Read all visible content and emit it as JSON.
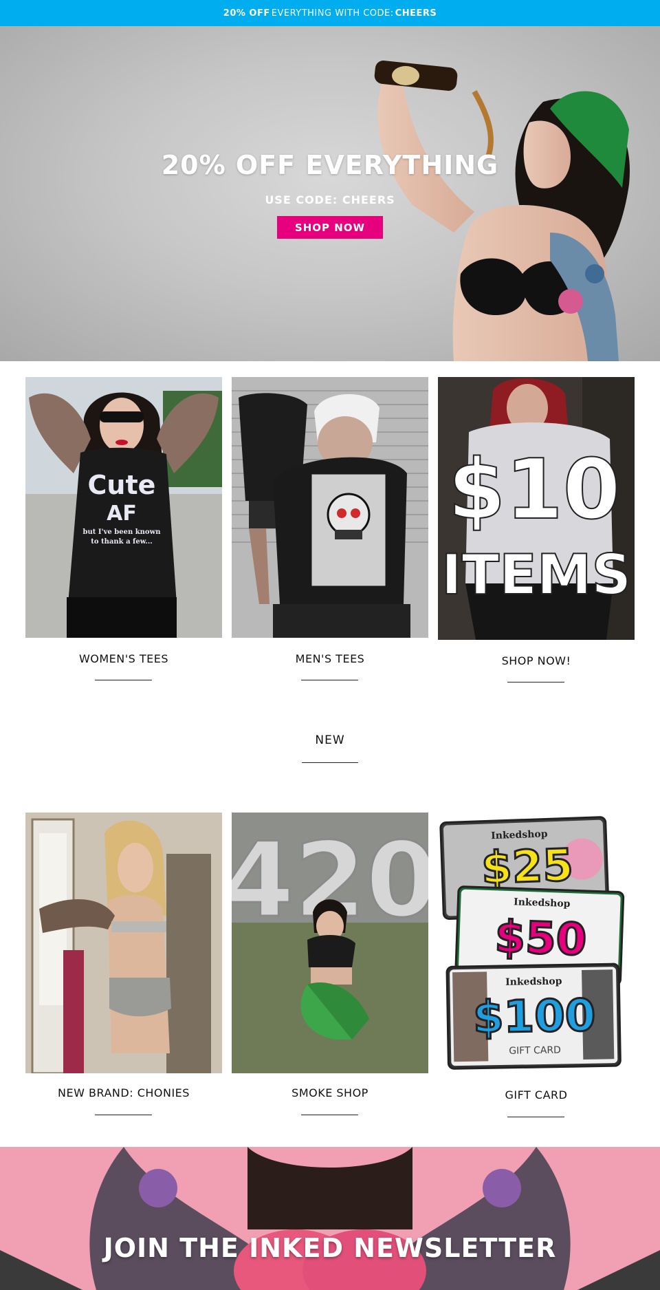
{
  "promo_bar": {
    "prefix": "20% OFF",
    "middle": "EVERYTHING WITH CODE:",
    "code": "CHEERS"
  },
  "hero": {
    "title": "20% OFF EVERYTHING",
    "subtitle": "USE CODE: CHEERS",
    "button": "SHOP NOW"
  },
  "tiles": [
    {
      "label": "WOMEN'S TEES",
      "shirt_text_1": "Cute",
      "shirt_text_2": "AF",
      "shirt_text_3": "but I've been known",
      "shirt_text_4": "to thank a few..."
    },
    {
      "label": "MEN'S TEES"
    },
    {
      "label": "SHOP NOW!",
      "image_text_1": "$10",
      "image_text_2": "ITEMS"
    }
  ],
  "new_section": {
    "label": "NEW"
  },
  "tiles_new": [
    {
      "label": "NEW BRAND: CHONIES"
    },
    {
      "label": "SMOKE SHOP",
      "balloon_text": "420"
    },
    {
      "label": "GIFT CARD",
      "cards": [
        {
          "brand": "Inkedshop",
          "amount": "$25",
          "color": "#f7e21a"
        },
        {
          "brand": "Inkedshop",
          "amount": "$50",
          "color": "#e6007e"
        },
        {
          "brand": "Inkedshop",
          "amount": "$100",
          "color": "#1f9fe0",
          "caption": "GIFT CARD"
        }
      ]
    }
  ],
  "newsletter": {
    "title": "JOIN THE INKED NEWSLETTER"
  },
  "colors": {
    "promo_bar": "#00aeef",
    "button": "#e6007e",
    "newsletter_bg": "#f0a0b2"
  }
}
